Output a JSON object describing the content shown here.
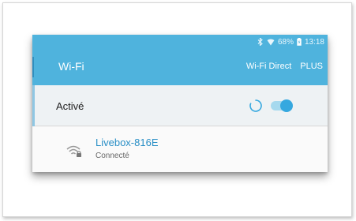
{
  "status_bar": {
    "battery": "68%",
    "time": "13:18"
  },
  "header": {
    "title": "Wi-Fi",
    "actions": [
      "Wi-Fi Direct",
      "PLUS"
    ]
  },
  "wifi_switch": {
    "label": "Activé",
    "on": true
  },
  "networks": [
    {
      "name": "Livebox-816E",
      "status": "Connecté",
      "secured": true
    }
  ],
  "colors": {
    "accent": "#4fb3dd",
    "network_name": "#2a8fc6",
    "toggle_knob": "#36a8df"
  }
}
